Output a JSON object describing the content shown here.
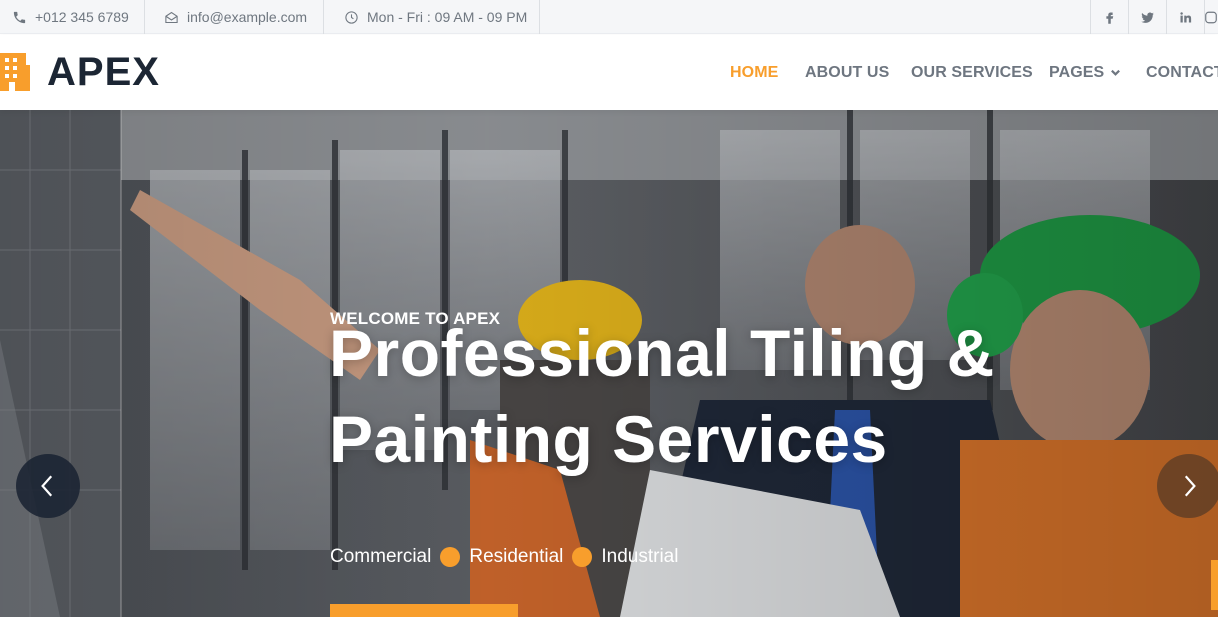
{
  "topbar": {
    "phone": "+012 345 6789",
    "email": "info@example.com",
    "hours": "Mon - Fri : 09 AM - 09 PM",
    "social": [
      {
        "icon": "facebook-icon",
        "label": "f"
      },
      {
        "icon": "twitter-icon",
        "label": ""
      },
      {
        "icon": "linkedin-icon",
        "label": "in"
      },
      {
        "icon": "instagram-icon",
        "label": ""
      }
    ]
  },
  "brand": {
    "name": "APEX",
    "accent": "#f89e2c",
    "dark": "#1c2634"
  },
  "nav": {
    "items": [
      "HOME",
      "ABOUT US",
      "OUR SERVICES",
      "PAGES",
      "CONTACT"
    ],
    "active": "HOME"
  },
  "hero": {
    "eyebrow": "WELCOME TO APEX",
    "title": "Professional Tiling & Painting Services",
    "tags": [
      "Commercial",
      "Residential",
      "Industrial"
    ]
  }
}
